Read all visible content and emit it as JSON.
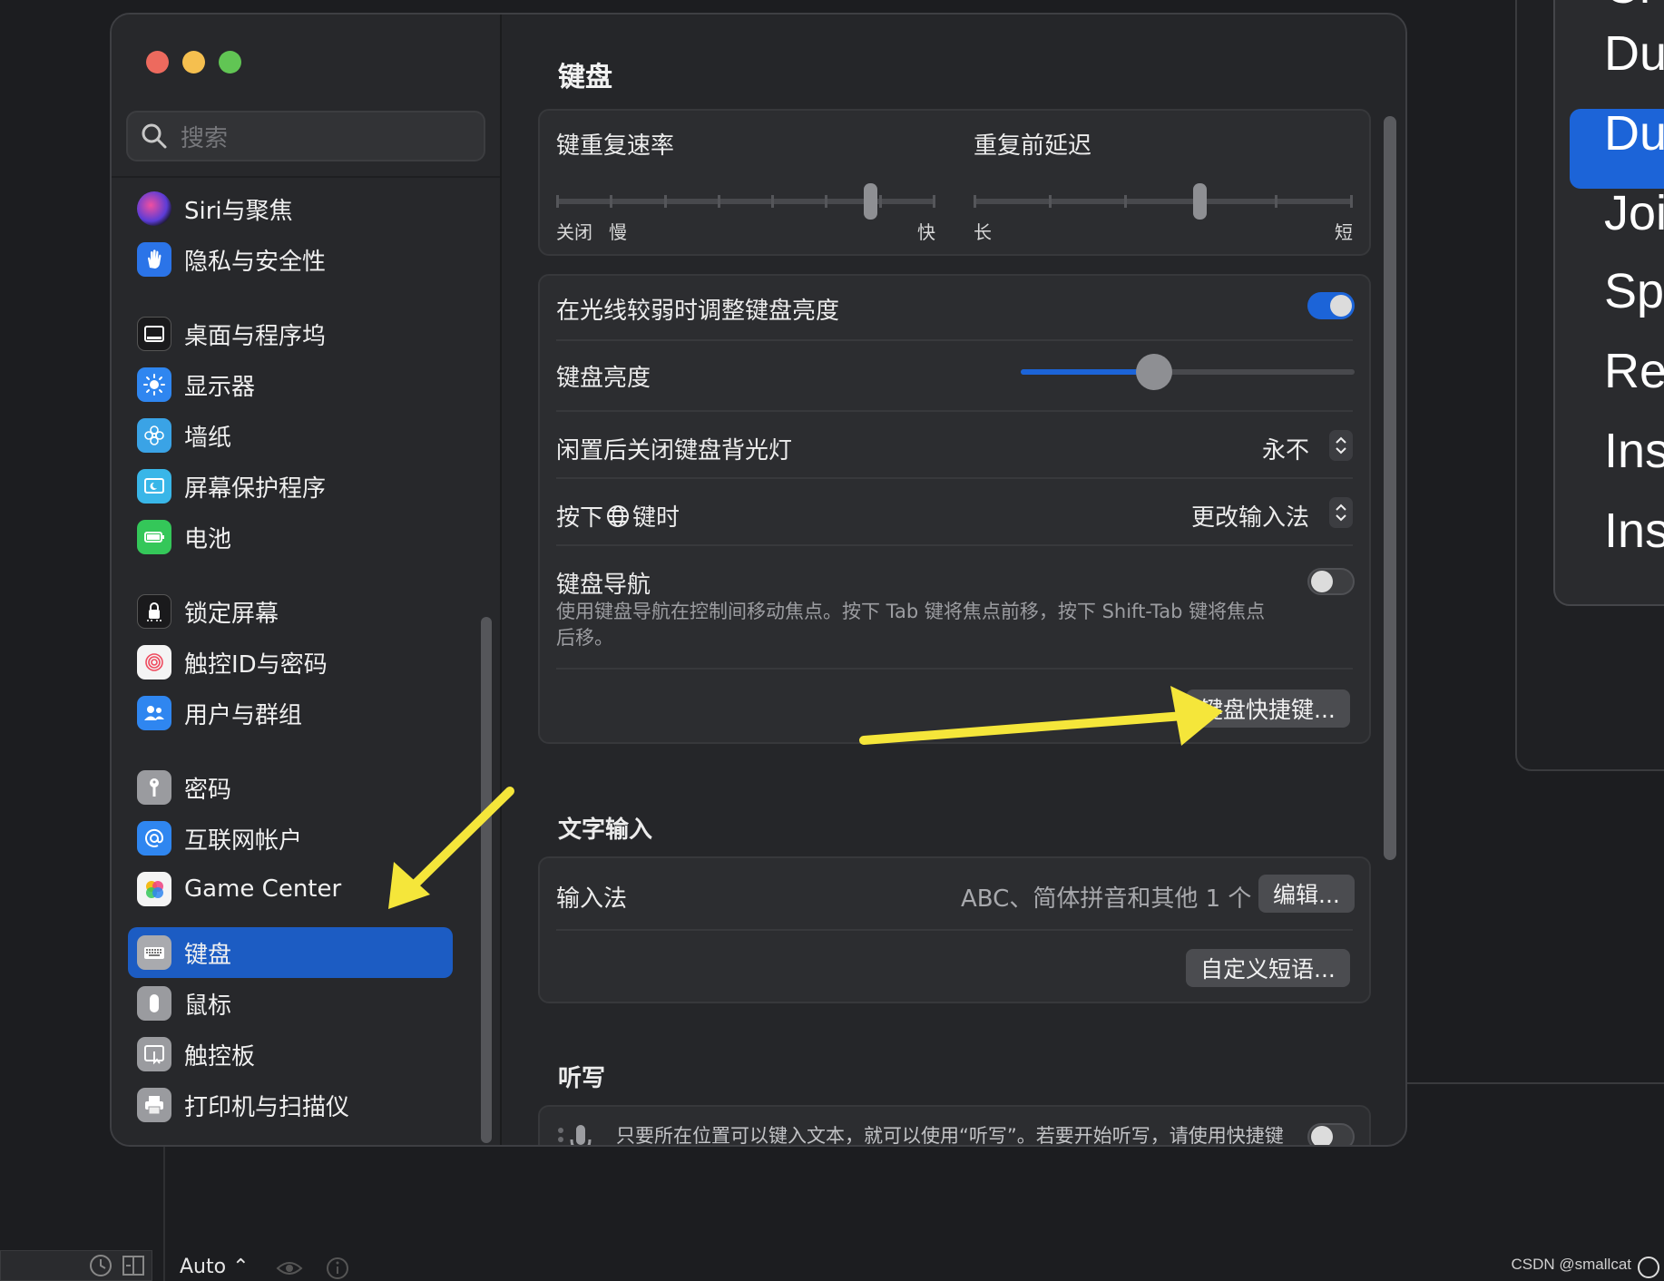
{
  "sidebar": {
    "search_placeholder": "搜索",
    "items": [
      {
        "label": "Siri与聚焦",
        "icon": "siri-icon"
      },
      {
        "label": "隐私与安全性",
        "icon": "hand-icon"
      },
      {
        "label": "桌面与程序坞",
        "icon": "dock-icon"
      },
      {
        "label": "显示器",
        "icon": "sun-icon"
      },
      {
        "label": "墙纸",
        "icon": "flower-icon"
      },
      {
        "label": "屏幕保护程序",
        "icon": "screensaver-icon"
      },
      {
        "label": "电池",
        "icon": "battery-icon"
      },
      {
        "label": "锁定屏幕",
        "icon": "lock-icon"
      },
      {
        "label": "触控ID与密码",
        "icon": "fingerprint-icon"
      },
      {
        "label": "用户与群组",
        "icon": "users-icon"
      },
      {
        "label": "密码",
        "icon": "key-icon"
      },
      {
        "label": "互联网帐户",
        "icon": "at-icon"
      },
      {
        "label": "Game Center",
        "icon": "game-center-icon"
      },
      {
        "label": "键盘",
        "icon": "keyboard-icon",
        "selected": true
      },
      {
        "label": "鼠标",
        "icon": "mouse-icon"
      },
      {
        "label": "触控板",
        "icon": "trackpad-icon"
      },
      {
        "label": "打印机与扫描仪",
        "icon": "printer-icon"
      }
    ]
  },
  "main": {
    "title": "键盘",
    "repeat": {
      "rate_label": "键重复速率",
      "rate_off": "关闭",
      "rate_slow": "慢",
      "rate_fast": "快",
      "rate_value_fraction": 0.84,
      "delay_label": "重复前延迟",
      "delay_long": "长",
      "delay_short": "短",
      "delay_value_fraction": 0.6
    },
    "backlight": {
      "auto_adjust_label": "在光线较弱时调整键盘亮度",
      "auto_adjust_on": true,
      "brightness_label": "键盘亮度",
      "brightness_fraction": 0.4,
      "idle_off_label": "闲置后关闭键盘背光灯",
      "idle_off_value": "永不",
      "globe_key_label_prefix": "按下",
      "globe_key_label_suffix": "键时",
      "globe_key_value": "更改输入法",
      "nav_label": "键盘导航",
      "nav_description": "使用键盘导航在控制间移动焦点。按下 Tab 键将焦点前移，按下 Shift-Tab 键将焦点后移。",
      "nav_on": false,
      "shortcuts_button": "键盘快捷键..."
    },
    "text_input": {
      "section_title": "文字输入",
      "input_sources_label": "输入法",
      "input_sources_value": "ABC、简体拼音和其他 1 个",
      "edit_button": "编辑...",
      "text_replacements_button": "自定义短语..."
    },
    "dictation": {
      "section_title": "听写",
      "description": "只要所在位置可以键入文本，就可以使用“听写”。若要开始听写，请使用快捷键或从“编辑”菜单中选择“开始听写”。",
      "on": false
    }
  },
  "background": {
    "menu_items": [
      "Cl",
      "Du",
      "Du",
      "Joi",
      "Sp",
      "Re",
      "Ins",
      "Ins"
    ],
    "bottom_zoom": "Auto",
    "watermark": "CSDN @smallcat"
  },
  "colors": {
    "accent": "#1c64d8",
    "annotation_arrow": "#f5e63a"
  }
}
